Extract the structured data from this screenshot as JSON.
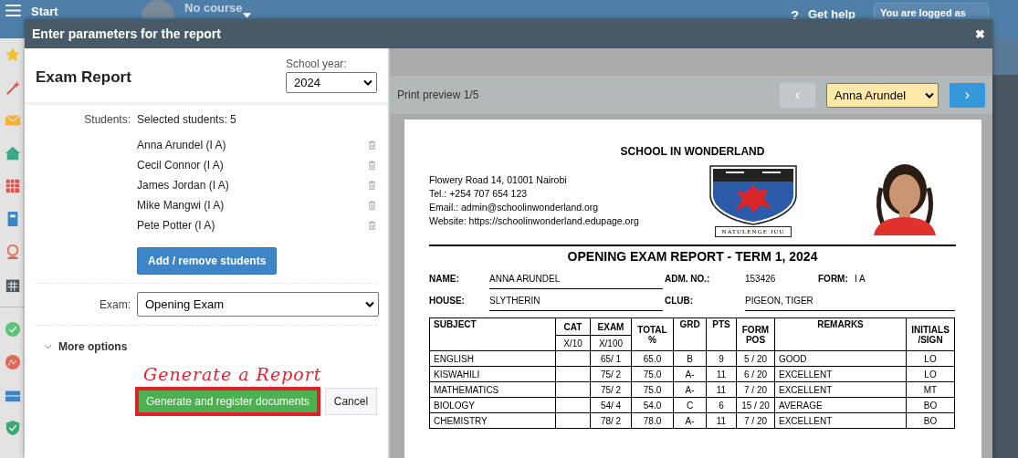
{
  "topbar": {
    "start": "Start",
    "course": "No course",
    "help_mark": "?",
    "help": "Get help",
    "login": "You are logged as"
  },
  "dialog": {
    "title": "Enter parameters for the report",
    "close": "✖"
  },
  "form": {
    "heading": "Exam Report",
    "year_label": "School year:",
    "year": "2024",
    "students_label": "Students:",
    "students_summary": "Selected students: 5",
    "students": [
      "Anna Arundel (I A)",
      "Cecil Connor (I A)",
      "James Jordan (I A)",
      "Mike Mangwi (I A)",
      "Pete Potter (I A)"
    ],
    "add_button": "Add / remove students",
    "exam_label": "Exam:",
    "exam": "Opening Exam",
    "more_options": "More options",
    "more_expanded": false,
    "annotation": "Generate a Report",
    "generate_button": "Generate and register documents",
    "cancel_button": "Cancel"
  },
  "preview": {
    "label": "Print preview 1/5",
    "prev": "‹",
    "student": "Anna Arundel",
    "next": "›"
  },
  "report": {
    "school": "SCHOOL IN WONDERLAND",
    "address": [
      "Flowery Road 14, 01001 Nairobi",
      "Tel.: +254 707 654 123",
      "Email.: admin@schoolinwonderland.org",
      "Website: https://schoolinwonderland.edupage.org"
    ],
    "motto": "NATULENGE JUU",
    "title": "OPENING EXAM REPORT - TERM 1, 2024",
    "info": [
      [
        {
          "label": "NAME:",
          "value": "ANNA ARUNDEL"
        },
        {
          "label": "ADM. NO.:",
          "value": "153426"
        },
        {
          "label": "FORM:",
          "value": "I A"
        }
      ],
      [
        {
          "label": "HOUSE:",
          "value": "SLYTHERIN"
        },
        {
          "label": "CLUB:",
          "value": "PIGEON, TIGER"
        }
      ]
    ],
    "columns": [
      {
        "label": "SUBJECT"
      },
      {
        "label": "CAT",
        "sub": "X/10"
      },
      {
        "label": "EXAM",
        "sub": "X/100"
      },
      {
        "label": "TOTAL",
        "label2": "%"
      },
      {
        "label": "GRD"
      },
      {
        "label": "PTS"
      },
      {
        "label": "FORM",
        "label2": "POS"
      },
      {
        "label": "REMARKS"
      },
      {
        "label": "INITIALS",
        "label2": "/SIGN"
      }
    ],
    "rows": [
      [
        "ENGLISH",
        "",
        "65/ 1",
        "65.0",
        "B",
        "9",
        "5 / 20",
        "GOOD",
        "LO"
      ],
      [
        "KISWAHILI",
        "",
        "75/ 2",
        "75.0",
        "A-",
        "11",
        "6 / 20",
        "EXCELLENT",
        "LO"
      ],
      [
        "MATHEMATICS",
        "",
        "75/ 2",
        "75.0",
        "A-",
        "11",
        "7 / 20",
        "EXCELLENT",
        "MT"
      ],
      [
        "BIOLOGY",
        "",
        "54/ 4",
        "54.0",
        "C",
        "6",
        "15 / 20",
        "AVERAGE",
        "BO"
      ],
      [
        "CHEMISTRY",
        "",
        "78/ 2",
        "78.0",
        "A-",
        "11",
        "7 / 20",
        "EXCELLENT",
        "BO"
      ]
    ]
  }
}
